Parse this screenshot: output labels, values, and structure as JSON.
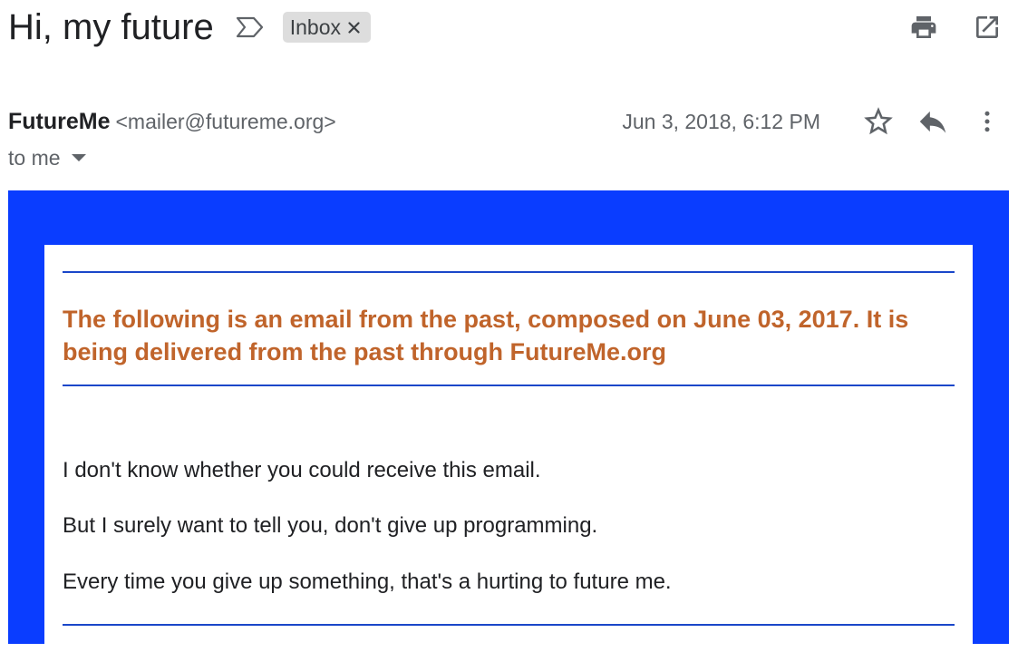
{
  "header": {
    "subject": "Hi, my future",
    "label_chip": "Inbox",
    "icons": {
      "important": "important-marker-icon",
      "remove_label": "close-icon",
      "print": "print-icon",
      "open_new_window": "open-in-new-icon"
    }
  },
  "sender": {
    "name": "FutureMe",
    "email": "<mailer@futureme.org>",
    "recipient": "to me",
    "date": "Jun 3, 2018, 6:12 PM",
    "icons": {
      "star": "star-icon",
      "reply": "reply-icon",
      "more": "more-vertical-icon",
      "caret": "caret-down-icon"
    }
  },
  "email": {
    "notice": "The following is an email from the past, composed on June 03, 2017. It is being delivered from the past through FutureMe.org",
    "lines": [
      "I don't know whether you could receive this email.",
      "But I surely want to tell you, don't give up programming.",
      "Every time you give up something, that's a hurting to future me."
    ]
  },
  "colors": {
    "frame_blue": "#0a3dff",
    "rule_blue": "#1a47c9",
    "notice_orange": "#c0642b",
    "chip_gray": "#dddddd",
    "icon_gray": "#5f6368"
  }
}
